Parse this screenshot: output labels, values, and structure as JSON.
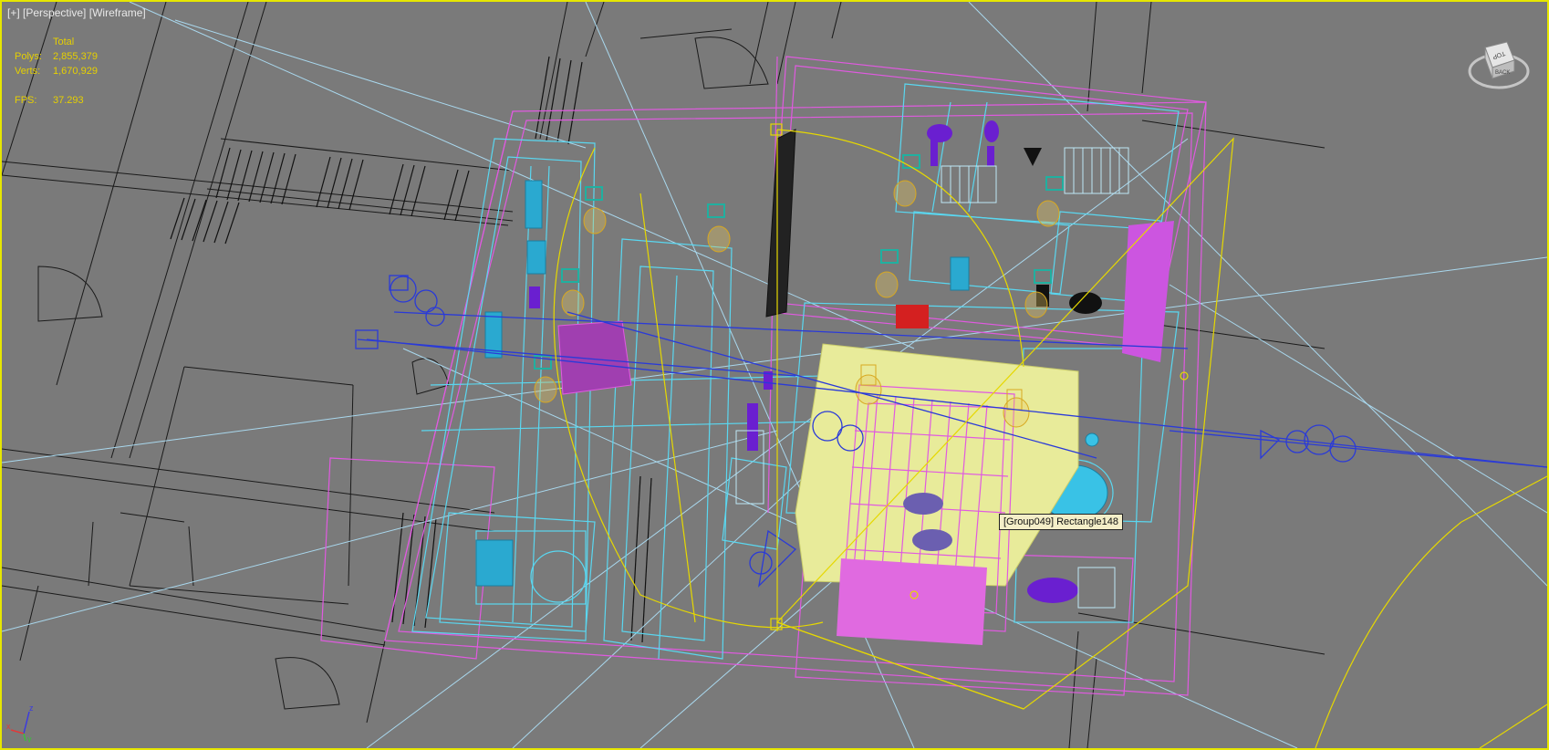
{
  "viewport": {
    "label_plus": "[+]",
    "label_view": "[Perspective]",
    "label_mode": "[Wireframe]"
  },
  "stats": {
    "header": "Total",
    "polys_label": "Polys:",
    "polys_value": "2,855,379",
    "verts_label": "Verts:",
    "verts_value": "1,670,929",
    "fps_label": "FPS:",
    "fps_value": "37.293"
  },
  "tooltip": {
    "text": "[Group049] Rectangle148"
  },
  "viewcube": {
    "icon": "viewcube-icon",
    "top_face": "TOP",
    "back_face": "BACK"
  },
  "axis_gizmo": {
    "icon": "axis-tripod-icon",
    "x": "x",
    "y": "y",
    "z": "z"
  },
  "colors": {
    "background": "#7a7a7a",
    "viewport_border": "#e6e600",
    "stats_text": "#e6d000",
    "wire_black": "#1a1a1a",
    "wire_cyan": "#5ad7f0",
    "wire_magenta": "#e05ae0",
    "wire_blue": "#2a3ad8",
    "wire_lightblue": "#a9d8ee",
    "wire_yellow": "#e6d800",
    "rug_yellow": "#e8eb9a",
    "purple_solid": "#6a1fd0",
    "magenta_solid": "#cc55e0"
  }
}
